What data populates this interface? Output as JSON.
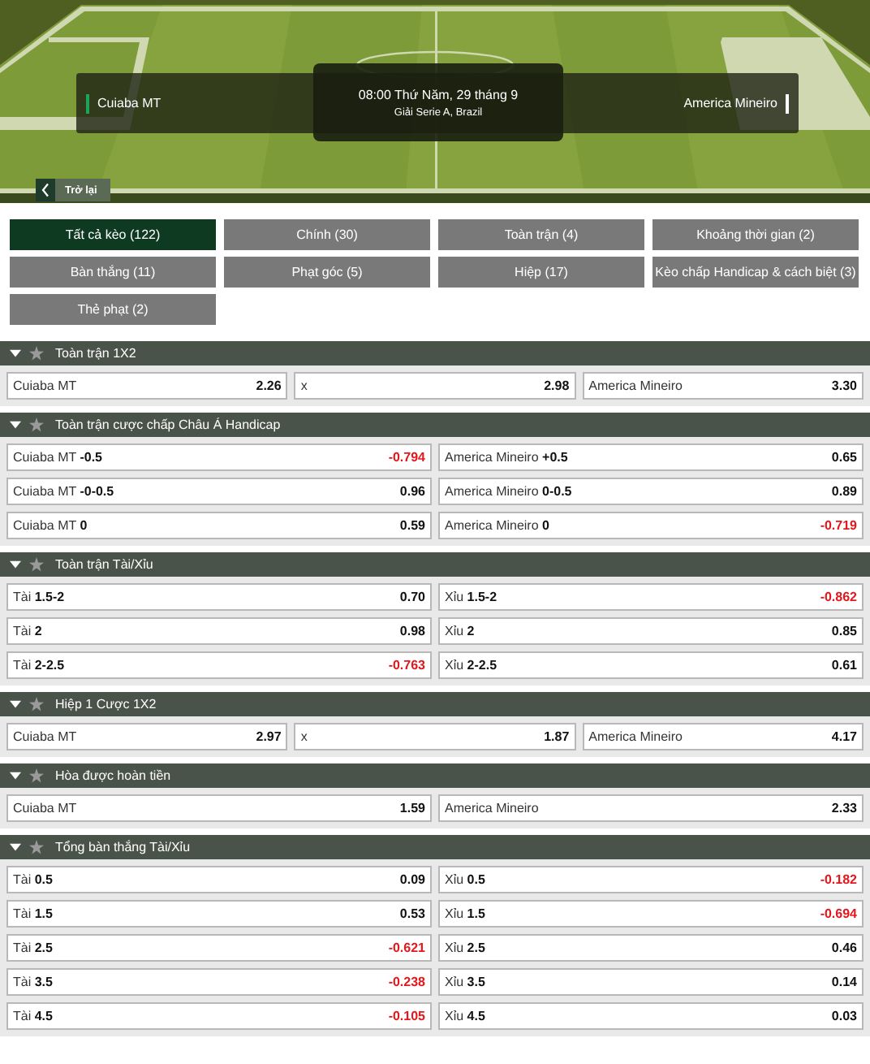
{
  "match": {
    "home": "Cuiaba MT",
    "away": "America Mineiro",
    "time": "08:00 Thứ Năm, 29 tháng 9",
    "league": "Giải Serie A, Brazil"
  },
  "back": {
    "label": "Trở lại"
  },
  "filters": [
    {
      "label": "Tất cả kèo (122)",
      "selected": true
    },
    {
      "label": "Chính (30)",
      "selected": false
    },
    {
      "label": "Toàn trận (4)",
      "selected": false
    },
    {
      "label": "Khoảng thời gian (2)",
      "selected": false
    },
    {
      "label": "Bàn thắng (11)",
      "selected": false
    },
    {
      "label": "Phạt góc (5)",
      "selected": false
    },
    {
      "label": "Hiệp (17)",
      "selected": false
    },
    {
      "label": "Kèo chấp Handicap & cách biệt (3)",
      "selected": false
    },
    {
      "label": "Thẻ phạt (2)",
      "selected": false
    }
  ],
  "markets": [
    {
      "title": "Toàn trận 1X2",
      "expanded": true,
      "favorite": false,
      "rows": [
        [
          {
            "label": "Cuiaba MT",
            "odds": "2.26",
            "negative": false
          },
          {
            "label": "x",
            "odds": "2.98",
            "negative": false
          },
          {
            "label": "America Mineiro",
            "odds": "3.30",
            "negative": false
          }
        ]
      ]
    },
    {
      "title": "Toàn trận cược chấp Châu Á Handicap",
      "expanded": true,
      "favorite": false,
      "rows": [
        [
          {
            "label": "Cuiaba MT **-0.5**",
            "odds": "-0.794",
            "negative": true
          },
          {
            "label": "America Mineiro **+0.5**",
            "odds": "0.65",
            "negative": false
          }
        ],
        [
          {
            "label": "Cuiaba MT **-0-0.5**",
            "odds": "0.96",
            "negative": false
          },
          {
            "label": "America Mineiro **0-0.5**",
            "odds": "0.89",
            "negative": false
          }
        ],
        [
          {
            "label": "Cuiaba MT **0**",
            "odds": "0.59",
            "negative": false
          },
          {
            "label": "America Mineiro **0**",
            "odds": "-0.719",
            "negative": true
          }
        ]
      ]
    },
    {
      "title": "Toàn trận Tài/Xỉu",
      "expanded": true,
      "favorite": false,
      "rows": [
        [
          {
            "label": "Tài **1.5-2**",
            "odds": "0.70",
            "negative": false
          },
          {
            "label": "Xỉu **1.5-2**",
            "odds": "-0.862",
            "negative": true
          }
        ],
        [
          {
            "label": "Tài **2**",
            "odds": "0.98",
            "negative": false
          },
          {
            "label": "Xỉu **2**",
            "odds": "0.85",
            "negative": false
          }
        ],
        [
          {
            "label": "Tài **2-2.5**",
            "odds": "-0.763",
            "negative": true
          },
          {
            "label": "Xỉu **2-2.5**",
            "odds": "0.61",
            "negative": false
          }
        ]
      ]
    },
    {
      "title": "Hiệp 1 Cược 1X2",
      "expanded": true,
      "favorite": false,
      "rows": [
        [
          {
            "label": "Cuiaba MT",
            "odds": "2.97",
            "negative": false
          },
          {
            "label": "x",
            "odds": "1.87",
            "negative": false
          },
          {
            "label": "America Mineiro",
            "odds": "4.17",
            "negative": false
          }
        ]
      ]
    },
    {
      "title": "Hòa được hoàn tiền",
      "expanded": true,
      "favorite": false,
      "rows": [
        [
          {
            "label": "Cuiaba MT",
            "odds": "1.59",
            "negative": false
          },
          {
            "label": "America Mineiro",
            "odds": "2.33",
            "negative": false
          }
        ]
      ]
    },
    {
      "title": "Tổng bàn thắng Tài/Xỉu",
      "expanded": true,
      "favorite": false,
      "rows": [
        [
          {
            "label": "Tài **0.5**",
            "odds": "0.09",
            "negative": false
          },
          {
            "label": "Xỉu **0.5**",
            "odds": "-0.182",
            "negative": true
          }
        ],
        [
          {
            "label": "Tài **1.5**",
            "odds": "0.53",
            "negative": false
          },
          {
            "label": "Xỉu **1.5**",
            "odds": "-0.694",
            "negative": true
          }
        ],
        [
          {
            "label": "Tài **2.5**",
            "odds": "-0.621",
            "negative": true
          },
          {
            "label": "Xỉu **2.5**",
            "odds": "0.46",
            "negative": false
          }
        ],
        [
          {
            "label": "Tài **3.5**",
            "odds": "-0.238",
            "negative": true
          },
          {
            "label": "Xỉu **3.5**",
            "odds": "0.14",
            "negative": false
          }
        ],
        [
          {
            "label": "Tài **4.5**",
            "odds": "-0.105",
            "negative": true
          },
          {
            "label": "Xỉu **4.5**",
            "odds": "0.03",
            "negative": false
          }
        ]
      ]
    }
  ]
}
